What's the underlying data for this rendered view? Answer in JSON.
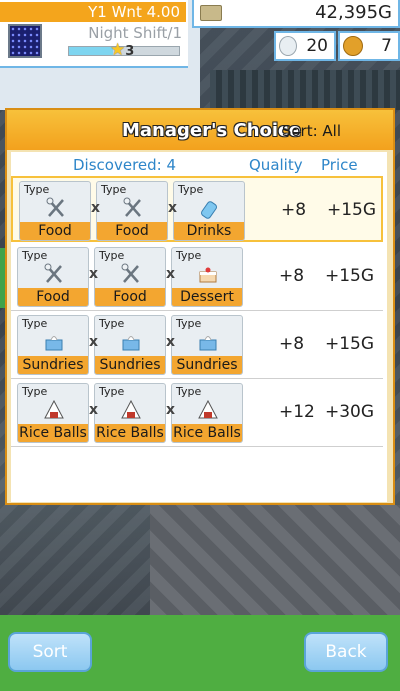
{
  "hud": {
    "season": "Y1 Wnt 4.00",
    "shift": "Night Shift/1",
    "rank": "3",
    "shift_progress": 0.4,
    "money": "42,395G",
    "bulbs": "20",
    "medals": "7"
  },
  "panel": {
    "title": "Manager's Choice",
    "sort": "Sort: All",
    "col_discovered": "Discovered: 4",
    "col_quality": "Quality",
    "col_price": "Price",
    "type_label": "Type",
    "separator": "x",
    "rows": [
      {
        "items": [
          {
            "label": "Food",
            "icon": "fork-knife-icon"
          },
          {
            "label": "Food",
            "icon": "fork-knife-icon"
          },
          {
            "label": "Drinks",
            "icon": "bottle-icon"
          }
        ],
        "quality": "+8",
        "price": "+15G",
        "selected": true
      },
      {
        "items": [
          {
            "label": "Food",
            "icon": "fork-knife-icon"
          },
          {
            "label": "Food",
            "icon": "fork-knife-icon"
          },
          {
            "label": "Dessert",
            "icon": "cake-icon"
          }
        ],
        "quality": "+8",
        "price": "+15G",
        "selected": false
      },
      {
        "items": [
          {
            "label": "Sundries",
            "icon": "tissue-box-icon"
          },
          {
            "label": "Sundries",
            "icon": "tissue-box-icon"
          },
          {
            "label": "Sundries",
            "icon": "tissue-box-icon"
          }
        ],
        "quality": "+8",
        "price": "+15G",
        "selected": false
      },
      {
        "items": [
          {
            "label": "Rice Balls",
            "icon": "rice-ball-icon"
          },
          {
            "label": "Rice Balls",
            "icon": "rice-ball-icon"
          },
          {
            "label": "Rice Balls",
            "icon": "rice-ball-icon"
          }
        ],
        "quality": "+12",
        "price": "+30G",
        "selected": false
      }
    ]
  },
  "buttons": {
    "sort": "Sort",
    "back": "Back"
  }
}
